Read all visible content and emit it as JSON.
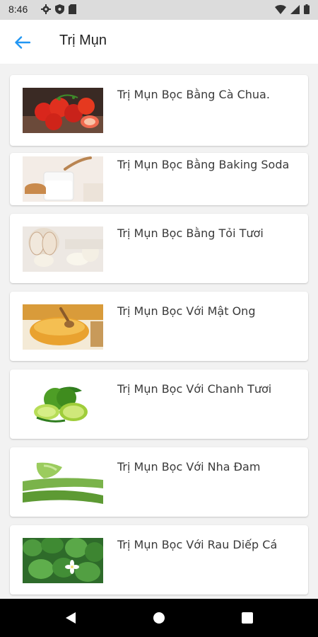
{
  "status_bar": {
    "time": "8:46",
    "left_icons": [
      "gear-icon",
      "shield-icon",
      "sd-card-icon"
    ],
    "right_icons": [
      "wifi-icon",
      "signal-icon",
      "battery-icon"
    ]
  },
  "app_bar": {
    "title": "Trị Mụn",
    "back_icon": "arrow-left-icon",
    "accent_color": "#2196f3"
  },
  "items": [
    {
      "title": "Trị Mụn Bọc Bằng Cà Chua.",
      "thumbnail": "tomatoes"
    },
    {
      "title": "Trị Mụn Bọc Bằng Baking Soda",
      "thumbnail": "baking-soda"
    },
    {
      "title": "Trị Mụn Bọc Bằng Tỏi Tươi",
      "thumbnail": "garlic"
    },
    {
      "title": "Trị Mụn Bọc Với Mật Ong",
      "thumbnail": "honey"
    },
    {
      "title": "Trị Mụn Bọc Với Chanh Tươi",
      "thumbnail": "lime"
    },
    {
      "title": "Trị Mụn Bọc Với Nha Đam",
      "thumbnail": "aloe-vera"
    },
    {
      "title": "Trị Mụn Bọc Với Rau Diếp Cá",
      "thumbnail": "fish-mint-leaves"
    }
  ],
  "nav_bar": {
    "buttons": [
      "back-triangle-icon",
      "home-circle-icon",
      "recents-square-icon"
    ]
  }
}
